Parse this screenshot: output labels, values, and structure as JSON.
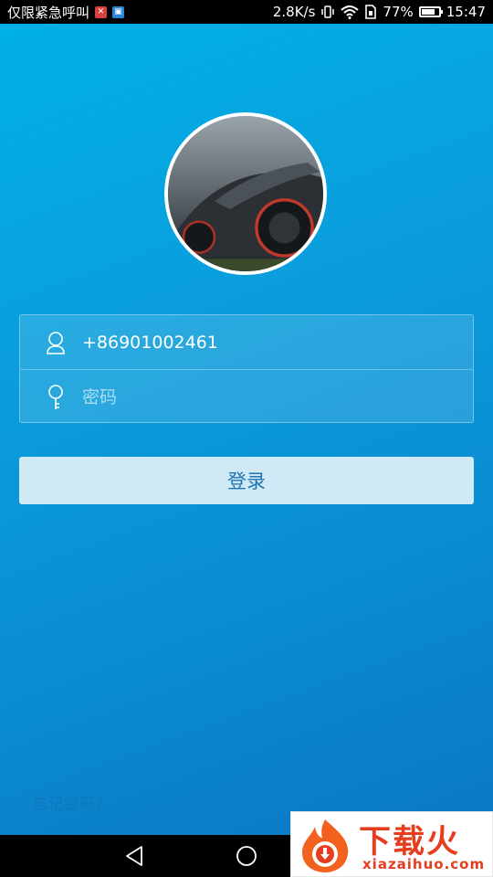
{
  "status_bar": {
    "carrier_text": "仅限紧急呼叫",
    "network_speed": "2.8K/s",
    "battery_percent": "77%",
    "battery_level": 0.77,
    "time": "15:47",
    "icons": [
      "notification-app-icon",
      "notification-app-icon-2",
      "vibrate-icon",
      "wifi-icon",
      "sim-icon",
      "battery-icon"
    ]
  },
  "login": {
    "avatar_alt": "sports car profile photo",
    "phone_value": "+86901002461",
    "password_placeholder": "密码",
    "login_button_label": "登录",
    "forgot_password_label": "忘记密码?"
  },
  "nav_bar": {
    "icons": [
      "back-icon",
      "home-icon"
    ]
  },
  "watermark": {
    "title": "下载火",
    "subtitle": "xiazaihuo.com"
  },
  "colors": {
    "background_top": "#00b0e6",
    "background_bottom": "#0b77c3",
    "button_bg": "#cfeaf5",
    "button_text": "#1f73b4",
    "watermark_red": "#e63d1e"
  }
}
